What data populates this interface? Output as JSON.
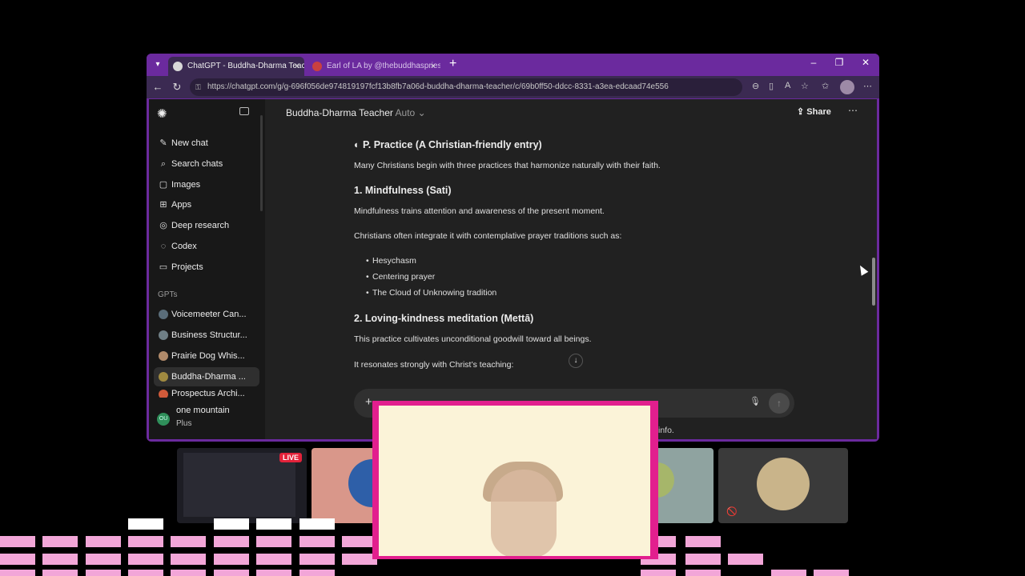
{
  "browser": {
    "tabs": [
      {
        "title": "ChatGPT - Buddha-Dharma Teach",
        "active": true,
        "favicon_color": "#d8d8d8"
      },
      {
        "title": "Earl of LA by @thebuddhaspriest",
        "active": false,
        "favicon_color": "#c94040"
      }
    ],
    "url": "https://chatgpt.com/g/g-696f056de974819197fcf13b8fb7a06d-buddha-dharma-teacher/c/69b0ff50-ddcc-8331-a3ea-edcaad74e556",
    "icons": {
      "tab_list": "▾",
      "new_tab": "+",
      "tab_close": "×",
      "back": "←",
      "refresh": "↻",
      "lock": "⚿",
      "minimize": "–",
      "restore": "❐",
      "close": "✕",
      "more": "⋯"
    }
  },
  "sidebar": {
    "nav": [
      {
        "label": "New chat",
        "icon": "✎"
      },
      {
        "label": "Search chats",
        "icon": "⌕"
      },
      {
        "label": "Images",
        "icon": "▢"
      },
      {
        "label": "Apps",
        "icon": "⊞"
      },
      {
        "label": "Deep research",
        "icon": "◎"
      },
      {
        "label": "Codex",
        "icon": "◌"
      },
      {
        "label": "Projects",
        "icon": "▭"
      }
    ],
    "gpts_label": "GPTs",
    "gpts": [
      {
        "label": "Voicemeeter Can...",
        "color": "#5a6d7a"
      },
      {
        "label": "Business Structur...",
        "color": "#6f7f86"
      },
      {
        "label": "Prairie Dog Whis...",
        "color": "#b08a6a"
      },
      {
        "label": "Buddha-Dharma ...",
        "color": "#a08a40"
      },
      {
        "label": "Prospectus Archi...",
        "color": "#d05a3a"
      }
    ],
    "user": {
      "initials": "OU",
      "name": "one mountain",
      "plan": "Plus"
    }
  },
  "header": {
    "gpt_name": "Buddha-Dharma Teacher",
    "mode": "Auto",
    "mode_chevron": "⌄",
    "share_label": "Share",
    "share_icon": "⇪",
    "more_icon": "⋯"
  },
  "conversation": {
    "section_title": "◐ P. Practice (A Christian-friendly entry)",
    "intro": "Many Christians begin with three practices that harmonize naturally with their faith.",
    "item1_title": "1. Mindfulness (Sati)",
    "item1_text": "Mindfulness trains attention and awareness of the present moment.",
    "item1_text2": "Christians often integrate it with contemplative prayer traditions such as:",
    "item1_bullets": [
      "Hesychasm",
      "Centering prayer",
      "The Cloud of Unknowing tradition"
    ],
    "item2_title": "2. Loving-kindness meditation (Mettā)",
    "item2_text": "This practice cultivates unconditional goodwill toward all beings.",
    "item2_text2": "It resonates strongly with Christ’s teaching:",
    "scroll_down_icon": "↓"
  },
  "composer": {
    "plus_icon": "+",
    "mic_icon": "🎙",
    "send_icon": "↑"
  },
  "footer_fragment": "info.",
  "stream": {
    "live_label": "LIVE",
    "muted_icon": "🚫"
  }
}
